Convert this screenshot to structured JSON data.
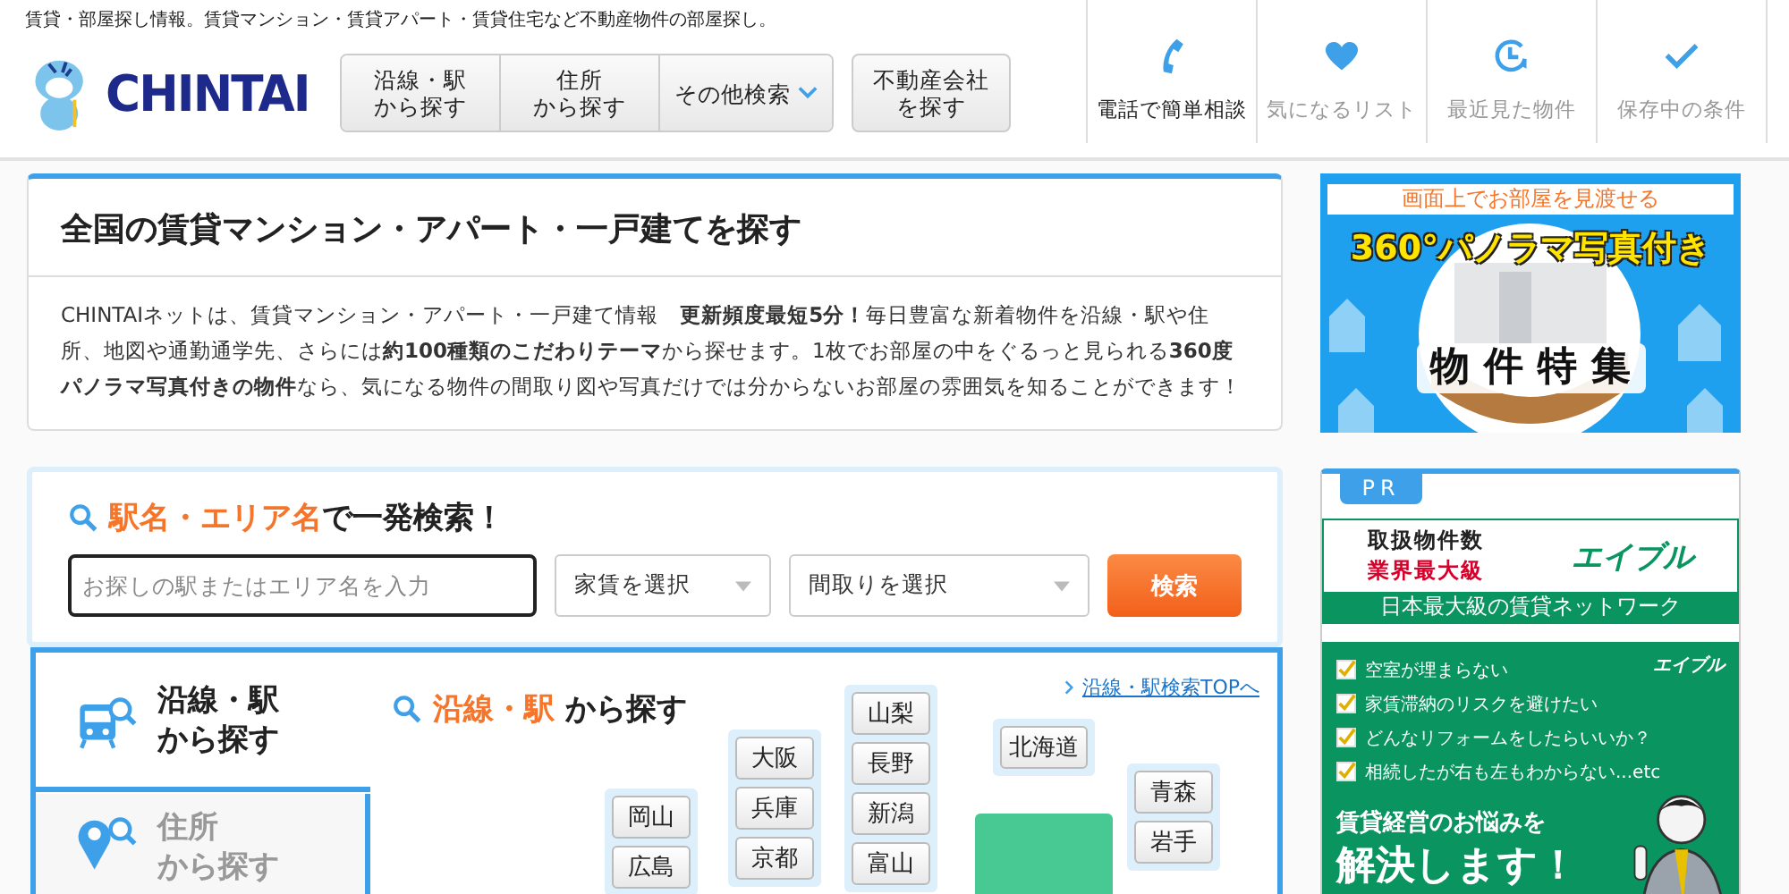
{
  "header": {
    "tagline": "賃貸・部屋探し情報。賃貸マンション・賃貸アパート・賃貸住宅など不動産物件の部屋探し。",
    "logo": "CHINTAI",
    "nav": [
      {
        "kind": "plain",
        "lines": [
          "沿線・駅",
          "から探す"
        ]
      },
      {
        "kind": "plain",
        "lines": [
          "住所",
          "から探す"
        ]
      },
      {
        "kind": "dropdown",
        "lines": [
          "その他検索"
        ]
      }
    ],
    "agent_button": [
      "不動産会社",
      "を探す"
    ],
    "quick_links": [
      {
        "label": "電話で簡単相談",
        "highlighted": true
      },
      {
        "label": "気になるリスト",
        "highlighted": false
      },
      {
        "label": "最近見た物件",
        "highlighted": false
      },
      {
        "label": "保存中の条件",
        "highlighted": false
      }
    ]
  },
  "intro": {
    "title": "全国の賃貸マンション・アパート・一戸建てを探す",
    "text": "CHINTAIネットは、賃貸マンション・アパート・一戸建て情報　**更新頻度最短5分！**毎日豊富な新着物件を沿線・駅や住所、地図や通勤通学先、さらには**約100種類のこだわりテーマ**から探せます。1枚でお部屋の中をぐるっと見られる**360度パノラマ写真付きの物件**なら、気になる物件の間取り図や写真だけでは分からないお部屋の雰囲気を知ることができます！"
  },
  "quick_search": {
    "heading_accent": "駅名・エリア名",
    "heading_rest": "で一発検索！",
    "field": {
      "placeholder": "お探しの駅またはエリア名を入力"
    },
    "selects": [
      "家賃を選択",
      "間取りを選択"
    ],
    "button": "検索"
  },
  "search_tabs": [
    {
      "lines": [
        "沿線・駅",
        "から探す"
      ],
      "selected": true
    },
    {
      "lines": [
        "住所",
        "から探す"
      ],
      "selected": false
    }
  ],
  "map": {
    "heading_accent": "沿線・駅",
    "heading_rest": "から探す",
    "top_link": "沿線・駅検索TOPへ",
    "regions": [
      {
        "prefectures": [
          "岡山",
          "広島"
        ]
      },
      {
        "prefectures": [
          "大阪",
          "兵庫",
          "京都"
        ]
      },
      {
        "prefectures": [
          "山梨",
          "長野",
          "新潟",
          "富山"
        ]
      },
      {
        "prefectures": [
          "北海道"
        ]
      },
      {
        "prefectures": [
          "青森",
          "岩手"
        ]
      }
    ]
  },
  "sidebar": {
    "banner": {
      "caption": "画面上でお部屋を見渡せる",
      "headline": "360°パノラマ写真付き",
      "title": "物件特集"
    },
    "pr": {
      "badge": "PR",
      "ad1": {
        "line1": "取扱物件数",
        "line2": "業界最大級",
        "brand": "エイブル",
        "strip": "日本最大級の賃貸ネットワーク"
      },
      "ad2": {
        "brand": "エイブル",
        "checks": [
          "空室が埋まらない",
          "家賃滞納のリスクを避けたい",
          "どんなリフォームをしたらいいか？",
          "相続したが右も左もわからない...etc"
        ],
        "line1": "賃貸経営のお悩みを",
        "line2": "解決します！"
      }
    }
  }
}
